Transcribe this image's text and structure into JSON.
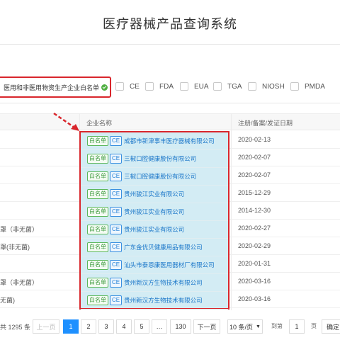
{
  "page": {
    "title": "医疗器械产品查询系统"
  },
  "filters": {
    "whitelist_label": "医用和非医用物资生产企业白名单",
    "options": [
      "CE",
      "FDA",
      "EUA",
      "TGA",
      "NIOSH",
      "PMDA"
    ]
  },
  "table": {
    "headers": {
      "company": "企业名称",
      "date": "注册/备案/发证日期"
    },
    "badges": {
      "whitelist": "白名单",
      "ce": "CE"
    },
    "rows": [
      {
        "left": "",
        "company": "成都市新津事丰医疗器械有限公司",
        "date": "2020-02-13"
      },
      {
        "left": "",
        "company": "三椒口腔健康股份有限公司",
        "date": "2020-02-07"
      },
      {
        "left": "",
        "company": "三椒口腔健康股份有限公司",
        "date": "2020-02-07"
      },
      {
        "left": "",
        "company": "贵州骏江实业有限公司",
        "date": "2015-12-29"
      },
      {
        "left": "",
        "company": "贵州骏江实业有限公司",
        "date": "2014-12-30"
      },
      {
        "left": "罩（非无菌）",
        "company": "贵州骏江实业有限公司",
        "date": "2020-02-27"
      },
      {
        "left": "罩(非无菌)",
        "company": "广东金优贝健康用品有限公司",
        "date": "2020-02-29"
      },
      {
        "left": "",
        "company": "汕头市泰恩康医用器材厂有限公司",
        "date": "2020-01-31"
      },
      {
        "left": "罩（非无菌）",
        "company": "贵州新汉方生物技术有限公司",
        "date": "2020-03-16"
      },
      {
        "left": "无菌)",
        "company": "贵州新汉方生物技术有限公司",
        "date": "2020-03-16"
      }
    ]
  },
  "pager": {
    "total": "共 1295 条",
    "prev": "上一页",
    "pages": [
      "1",
      "2",
      "3",
      "4",
      "5",
      "…",
      "130"
    ],
    "next": "下一页",
    "page_size": "10 条/页",
    "goto_label": "到第",
    "goto_value": "1",
    "page_unit": "页",
    "confirm": "确定"
  },
  "colors": {
    "accent": "#1e90ff",
    "highlight_border": "#d9262c",
    "highlight_fill": "#d3ecf4",
    "whitelist_green": "#52b043"
  }
}
